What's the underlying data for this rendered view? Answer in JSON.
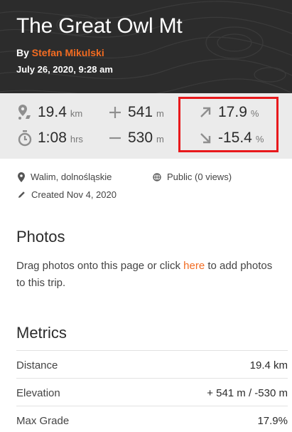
{
  "header": {
    "title": "The Great Owl Mt",
    "by_prefix": "By ",
    "author": "Stefan Mikulski",
    "date": "July 26, 2020, 9:28 am"
  },
  "stats": {
    "distance": {
      "value": "19.4",
      "unit": "km",
      "icon": "distance-pin-icon"
    },
    "duration": {
      "value": "1:08",
      "unit": "hrs",
      "icon": "stopwatch-icon"
    },
    "ascent": {
      "value": "541",
      "unit": "m",
      "icon": "plus-icon"
    },
    "descent": {
      "value": "530",
      "unit": "m",
      "icon": "minus-icon"
    },
    "max_grade": {
      "value": "17.9",
      "unit": "%",
      "icon": "arrow-up-right-icon"
    },
    "min_grade": {
      "value": "-15.4",
      "unit": "%",
      "icon": "arrow-down-right-icon"
    }
  },
  "meta": {
    "location": "Walim, dolnośląskie",
    "visibility": "Public (0 views)",
    "created": "Created Nov 4, 2020"
  },
  "photos": {
    "title": "Photos",
    "text_before": "Drag photos onto this page or click ",
    "link": "here",
    "text_after": " to add photos to this trip."
  },
  "metrics": {
    "title": "Metrics",
    "rows": [
      {
        "label": "Distance",
        "value": "19.4 km"
      },
      {
        "label": "Elevation",
        "value": "+ 541 m / -530 m"
      },
      {
        "label": "Max Grade",
        "value": "17.9%"
      }
    ]
  },
  "colors": {
    "accent": "#f26b21",
    "highlight": "#e8191c",
    "header_bg": "#2c2c2c",
    "stats_bg": "#ebebeb"
  }
}
